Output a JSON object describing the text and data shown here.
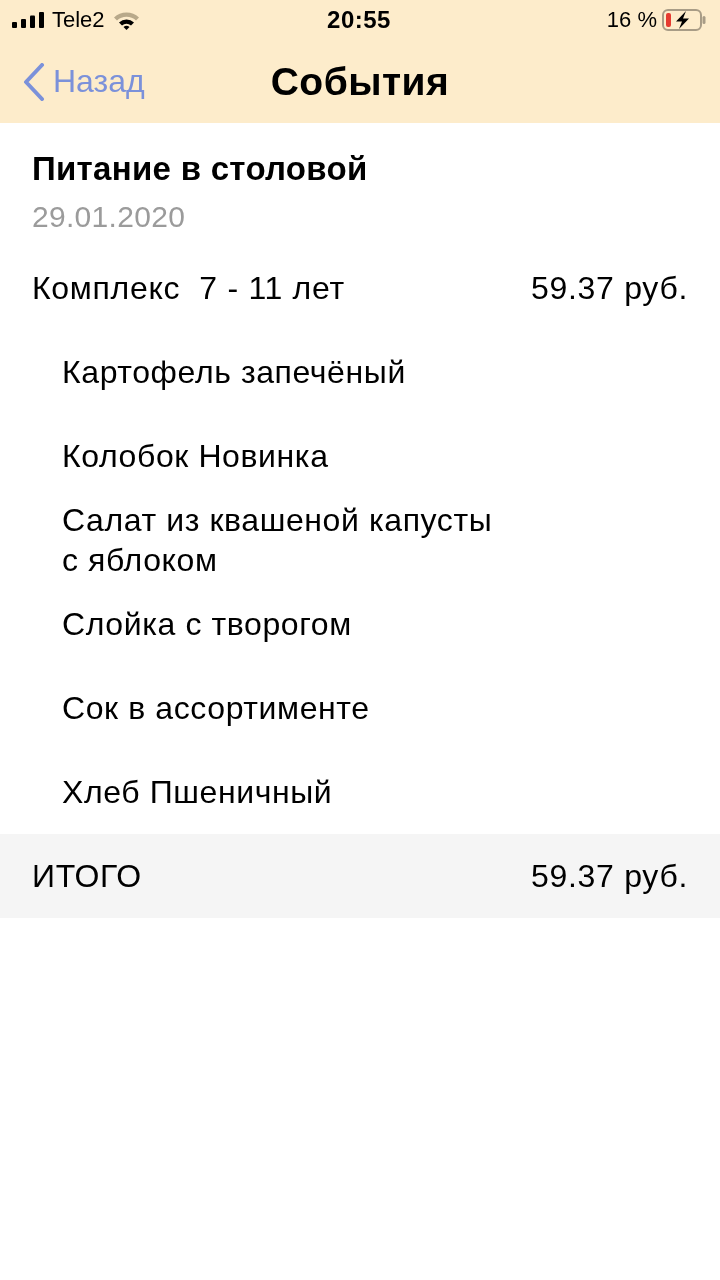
{
  "status_bar": {
    "carrier": "Tele2",
    "time": "20:55",
    "battery": "16 %"
  },
  "nav_bar": {
    "back": "Назад",
    "title": "События"
  },
  "event": {
    "title": "Питание в столовой",
    "date": "29.01.2020"
  },
  "order": {
    "name": "Комплекс  7 - 11 лет",
    "price": "59.37 руб.",
    "items": [
      "Картофель запечёный",
      "Колобок Новинка",
      "Салат из квашеной капусты с яблоком",
      "Слойка с творогом",
      "Сок в ассортименте",
      "Хлеб Пшеничный"
    ]
  },
  "total": {
    "label": "ИТОГО",
    "amount": "59.37 руб."
  }
}
